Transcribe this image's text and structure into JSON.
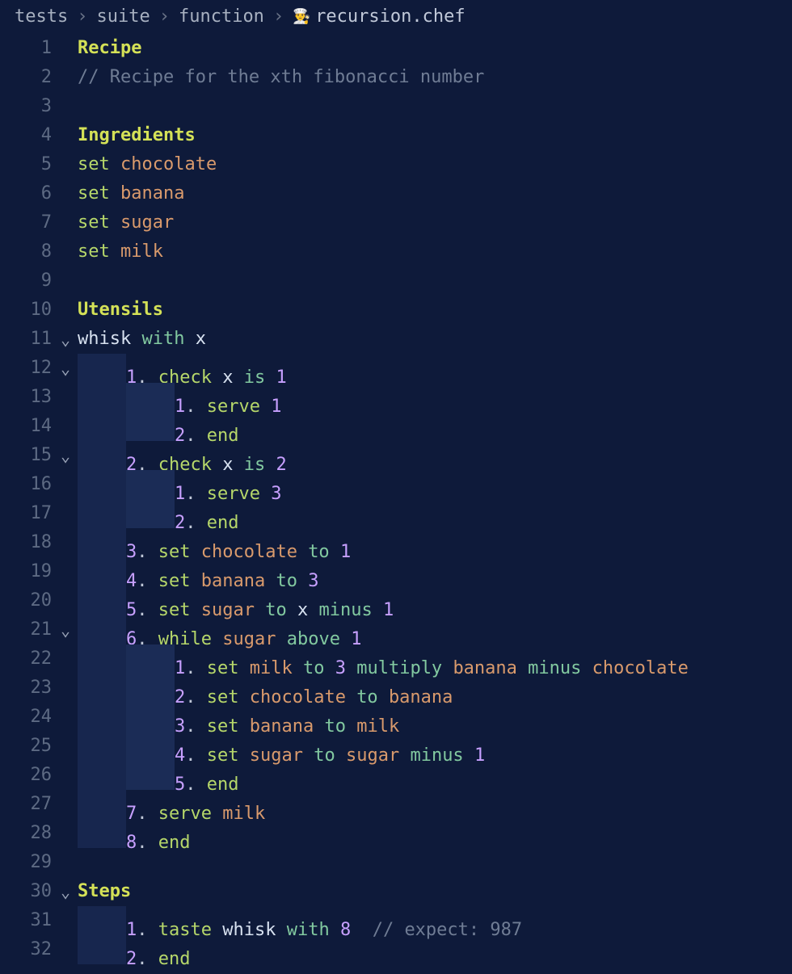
{
  "breadcrumb": {
    "segments": [
      "tests",
      "suite",
      "function"
    ],
    "file": "recursion.chef",
    "icon": "👨‍🍳"
  },
  "lines": [
    {
      "n": 1,
      "fold": "",
      "indent": 0,
      "tokens": [
        {
          "c": "c-head",
          "t": "Recipe"
        }
      ]
    },
    {
      "n": 2,
      "fold": "",
      "indent": 0,
      "tokens": [
        {
          "c": "c-comment",
          "t": "// Recipe for the xth fibonacci number"
        }
      ]
    },
    {
      "n": 3,
      "fold": "",
      "indent": 0,
      "tokens": []
    },
    {
      "n": 4,
      "fold": "",
      "indent": 0,
      "tokens": [
        {
          "c": "c-head",
          "t": "Ingredients"
        }
      ]
    },
    {
      "n": 5,
      "fold": "",
      "indent": 0,
      "tokens": [
        {
          "c": "c-kw",
          "t": "set "
        },
        {
          "c": "c-var",
          "t": "chocolate"
        }
      ]
    },
    {
      "n": 6,
      "fold": "",
      "indent": 0,
      "tokens": [
        {
          "c": "c-kw",
          "t": "set "
        },
        {
          "c": "c-var",
          "t": "banana"
        }
      ]
    },
    {
      "n": 7,
      "fold": "",
      "indent": 0,
      "tokens": [
        {
          "c": "c-kw",
          "t": "set "
        },
        {
          "c": "c-var",
          "t": "sugar"
        }
      ]
    },
    {
      "n": 8,
      "fold": "",
      "indent": 0,
      "tokens": [
        {
          "c": "c-kw",
          "t": "set "
        },
        {
          "c": "c-var",
          "t": "milk"
        }
      ]
    },
    {
      "n": 9,
      "fold": "",
      "indent": 0,
      "tokens": []
    },
    {
      "n": 10,
      "fold": "",
      "indent": 0,
      "tokens": [
        {
          "c": "c-head",
          "t": "Utensils"
        }
      ]
    },
    {
      "n": 11,
      "fold": "v",
      "indent": 0,
      "tokens": [
        {
          "c": "c-id",
          "t": "whisk "
        },
        {
          "c": "c-op",
          "t": "with "
        },
        {
          "c": "c-id",
          "t": "x"
        }
      ]
    },
    {
      "n": 12,
      "fold": "v",
      "indent": 1,
      "tokens": [
        {
          "c": "c-ord",
          "t": "1"
        },
        {
          "c": "c-dot",
          "t": ". "
        },
        {
          "c": "c-kw",
          "t": "check "
        },
        {
          "c": "c-id",
          "t": "x "
        },
        {
          "c": "c-op",
          "t": "is "
        },
        {
          "c": "c-num",
          "t": "1"
        }
      ]
    },
    {
      "n": 13,
      "fold": "",
      "indent": 2,
      "tokens": [
        {
          "c": "c-ord",
          "t": "1"
        },
        {
          "c": "c-dot",
          "t": ". "
        },
        {
          "c": "c-kw",
          "t": "serve "
        },
        {
          "c": "c-num",
          "t": "1"
        }
      ]
    },
    {
      "n": 14,
      "fold": "",
      "indent": 2,
      "tokens": [
        {
          "c": "c-ord",
          "t": "2"
        },
        {
          "c": "c-dot",
          "t": ". "
        },
        {
          "c": "c-kw",
          "t": "end"
        }
      ]
    },
    {
      "n": 15,
      "fold": "v",
      "indent": 1,
      "tokens": [
        {
          "c": "c-ord",
          "t": "2"
        },
        {
          "c": "c-dot",
          "t": ". "
        },
        {
          "c": "c-kw",
          "t": "check "
        },
        {
          "c": "c-id",
          "t": "x "
        },
        {
          "c": "c-op",
          "t": "is "
        },
        {
          "c": "c-num",
          "t": "2"
        }
      ]
    },
    {
      "n": 16,
      "fold": "",
      "indent": 2,
      "tokens": [
        {
          "c": "c-ord",
          "t": "1"
        },
        {
          "c": "c-dot",
          "t": ". "
        },
        {
          "c": "c-kw",
          "t": "serve "
        },
        {
          "c": "c-num",
          "t": "3"
        }
      ]
    },
    {
      "n": 17,
      "fold": "",
      "indent": 2,
      "tokens": [
        {
          "c": "c-ord",
          "t": "2"
        },
        {
          "c": "c-dot",
          "t": ". "
        },
        {
          "c": "c-kw",
          "t": "end"
        }
      ]
    },
    {
      "n": 18,
      "fold": "",
      "indent": 1,
      "tokens": [
        {
          "c": "c-ord",
          "t": "3"
        },
        {
          "c": "c-dot",
          "t": ". "
        },
        {
          "c": "c-kw",
          "t": "set "
        },
        {
          "c": "c-var",
          "t": "chocolate "
        },
        {
          "c": "c-op",
          "t": "to "
        },
        {
          "c": "c-num",
          "t": "1"
        }
      ]
    },
    {
      "n": 19,
      "fold": "",
      "indent": 1,
      "tokens": [
        {
          "c": "c-ord",
          "t": "4"
        },
        {
          "c": "c-dot",
          "t": ". "
        },
        {
          "c": "c-kw",
          "t": "set "
        },
        {
          "c": "c-var",
          "t": "banana "
        },
        {
          "c": "c-op",
          "t": "to "
        },
        {
          "c": "c-num",
          "t": "3"
        }
      ]
    },
    {
      "n": 20,
      "fold": "",
      "indent": 1,
      "tokens": [
        {
          "c": "c-ord",
          "t": "5"
        },
        {
          "c": "c-dot",
          "t": ". "
        },
        {
          "c": "c-kw",
          "t": "set "
        },
        {
          "c": "c-var",
          "t": "sugar "
        },
        {
          "c": "c-op",
          "t": "to "
        },
        {
          "c": "c-id",
          "t": "x "
        },
        {
          "c": "c-op",
          "t": "minus "
        },
        {
          "c": "c-num",
          "t": "1"
        }
      ]
    },
    {
      "n": 21,
      "fold": "v",
      "indent": 1,
      "tokens": [
        {
          "c": "c-ord",
          "t": "6"
        },
        {
          "c": "c-dot",
          "t": ". "
        },
        {
          "c": "c-kw",
          "t": "while "
        },
        {
          "c": "c-var",
          "t": "sugar "
        },
        {
          "c": "c-op",
          "t": "above "
        },
        {
          "c": "c-num",
          "t": "1"
        }
      ]
    },
    {
      "n": 22,
      "fold": "",
      "indent": 2,
      "tokens": [
        {
          "c": "c-ord",
          "t": "1"
        },
        {
          "c": "c-dot",
          "t": ". "
        },
        {
          "c": "c-kw",
          "t": "set "
        },
        {
          "c": "c-var",
          "t": "milk "
        },
        {
          "c": "c-op",
          "t": "to "
        },
        {
          "c": "c-num",
          "t": "3 "
        },
        {
          "c": "c-op",
          "t": "multiply "
        },
        {
          "c": "c-var",
          "t": "banana "
        },
        {
          "c": "c-op",
          "t": "minus "
        },
        {
          "c": "c-var",
          "t": "chocolate"
        }
      ]
    },
    {
      "n": 23,
      "fold": "",
      "indent": 2,
      "tokens": [
        {
          "c": "c-ord",
          "t": "2"
        },
        {
          "c": "c-dot",
          "t": ". "
        },
        {
          "c": "c-kw",
          "t": "set "
        },
        {
          "c": "c-var",
          "t": "chocolate "
        },
        {
          "c": "c-op",
          "t": "to "
        },
        {
          "c": "c-var",
          "t": "banana"
        }
      ]
    },
    {
      "n": 24,
      "fold": "",
      "indent": 2,
      "tokens": [
        {
          "c": "c-ord",
          "t": "3"
        },
        {
          "c": "c-dot",
          "t": ". "
        },
        {
          "c": "c-kw",
          "t": "set "
        },
        {
          "c": "c-var",
          "t": "banana "
        },
        {
          "c": "c-op",
          "t": "to "
        },
        {
          "c": "c-var",
          "t": "milk"
        }
      ]
    },
    {
      "n": 25,
      "fold": "",
      "indent": 2,
      "tokens": [
        {
          "c": "c-ord",
          "t": "4"
        },
        {
          "c": "c-dot",
          "t": ". "
        },
        {
          "c": "c-kw",
          "t": "set "
        },
        {
          "c": "c-var",
          "t": "sugar "
        },
        {
          "c": "c-op",
          "t": "to "
        },
        {
          "c": "c-var",
          "t": "sugar "
        },
        {
          "c": "c-op",
          "t": "minus "
        },
        {
          "c": "c-num",
          "t": "1"
        }
      ]
    },
    {
      "n": 26,
      "fold": "",
      "indent": 2,
      "tokens": [
        {
          "c": "c-ord",
          "t": "5"
        },
        {
          "c": "c-dot",
          "t": ". "
        },
        {
          "c": "c-kw",
          "t": "end"
        }
      ]
    },
    {
      "n": 27,
      "fold": "",
      "indent": 1,
      "tokens": [
        {
          "c": "c-ord",
          "t": "7"
        },
        {
          "c": "c-dot",
          "t": ". "
        },
        {
          "c": "c-kw",
          "t": "serve "
        },
        {
          "c": "c-var",
          "t": "milk"
        }
      ]
    },
    {
      "n": 28,
      "fold": "",
      "indent": 1,
      "tokens": [
        {
          "c": "c-ord",
          "t": "8"
        },
        {
          "c": "c-dot",
          "t": ". "
        },
        {
          "c": "c-kw",
          "t": "end"
        }
      ]
    },
    {
      "n": 29,
      "fold": "",
      "indent": 0,
      "tokens": []
    },
    {
      "n": 30,
      "fold": "v",
      "indent": 0,
      "tokens": [
        {
          "c": "c-head",
          "t": "Steps"
        }
      ]
    },
    {
      "n": 31,
      "fold": "",
      "indent": 1,
      "tokens": [
        {
          "c": "c-ord",
          "t": "1"
        },
        {
          "c": "c-dot",
          "t": ". "
        },
        {
          "c": "c-kw",
          "t": "taste "
        },
        {
          "c": "c-id",
          "t": "whisk "
        },
        {
          "c": "c-op",
          "t": "with "
        },
        {
          "c": "c-num",
          "t": "8  "
        },
        {
          "c": "c-comment",
          "t": "// expect: 987"
        }
      ]
    },
    {
      "n": 32,
      "fold": "",
      "indent": 1,
      "tokens": [
        {
          "c": "c-ord",
          "t": "2"
        },
        {
          "c": "c-dot",
          "t": ". "
        },
        {
          "c": "c-kw",
          "t": "end"
        }
      ]
    }
  ]
}
